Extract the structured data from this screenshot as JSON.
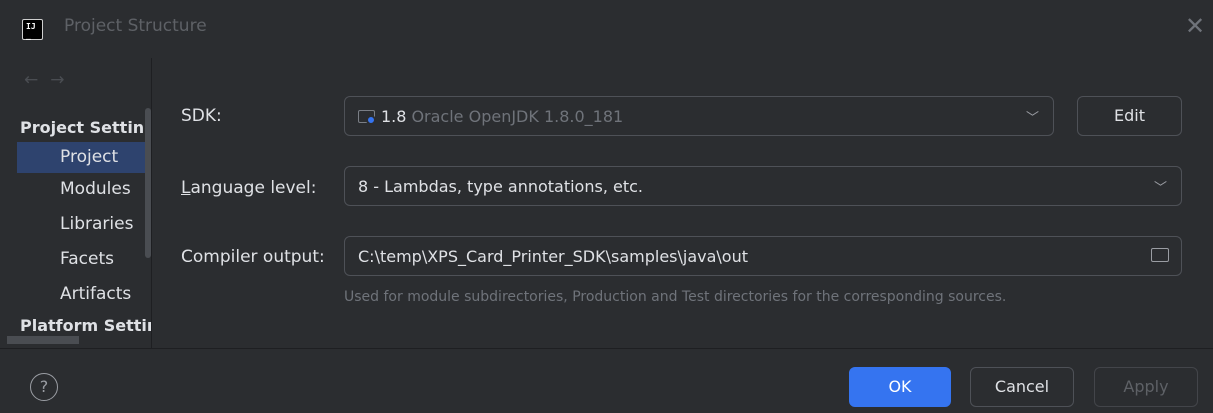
{
  "window": {
    "title": "Project Structure",
    "close_glyph": "✕"
  },
  "sidebar": {
    "nav_back": "←",
    "nav_forward": "→",
    "group_project": "Project Setting",
    "items": [
      {
        "label": "Project",
        "selected": true
      },
      {
        "label": "Modules",
        "selected": false
      },
      {
        "label": "Libraries",
        "selected": false
      },
      {
        "label": "Facets",
        "selected": false
      },
      {
        "label": "Artifacts",
        "selected": false
      }
    ],
    "group_platform": "Platform Settir"
  },
  "project": {
    "sdk_label": "SDK:",
    "sdk_version": "1.8",
    "sdk_name": "Oracle OpenJDK 1.8.0_181",
    "edit_label": "Edit",
    "language_level_label_underlined": "L",
    "language_level_label_rest": "anguage level:",
    "language_level_value": "8 - Lambdas, type annotations, etc.",
    "compiler_output_label": "Compiler output:",
    "compiler_output_value": "C:\\temp\\XPS_Card_Printer_SDK\\samples\\java\\out",
    "compiler_output_hint": "Used for module subdirectories, Production and Test directories for the corresponding sources."
  },
  "footer": {
    "help_glyph": "?",
    "ok_label": "OK",
    "cancel_label": "Cancel",
    "apply_label": "Apply"
  },
  "colors": {
    "background": "#2b2d30",
    "accent": "#3574f0",
    "selection": "#2e436e",
    "text": "#dfe1e5",
    "muted_text": "#6f737a"
  }
}
